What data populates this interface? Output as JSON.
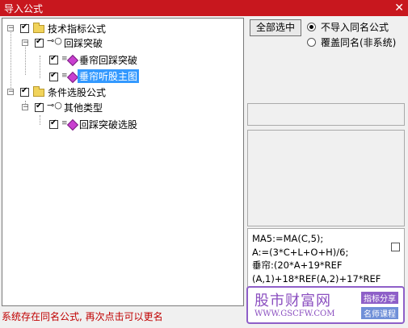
{
  "window": {
    "title": "导入公式",
    "close_glyph": "✕"
  },
  "tree": {
    "nodes": [
      {
        "label": "技术指标公式",
        "expander": "−",
        "icon": "folder-icon",
        "checked": true
      },
      {
        "label": "回踩突破",
        "expander": "−",
        "icon": "key-icon",
        "checked": true
      },
      {
        "label": "垂帘回踩突破",
        "icon": "formula-icon",
        "checked": true
      },
      {
        "label": "垂帘听股主图",
        "icon": "formula-icon",
        "checked": true,
        "selected": true
      },
      {
        "label": "条件选股公式",
        "expander": "−",
        "icon": "folder-icon",
        "checked": true
      },
      {
        "label": "其他类型",
        "expander": "−",
        "icon": "key-icon",
        "checked": true
      },
      {
        "label": "回踩突破选股",
        "icon": "formula-icon",
        "checked": true
      }
    ]
  },
  "buttons": {
    "select_all": "全部选中"
  },
  "options": {
    "no_import": "不导入同名公式",
    "overwrite": "覆盖同名(非系统)",
    "selected": "no_import"
  },
  "formula_preview": {
    "lines": [
      "MA5:=MA(C,5);",
      "A:=(3*C+L+O+H)/6;",
      "垂帘:(20*A+19*REF",
      "(A,1)+18*REF(A,2)+17*REF"
    ]
  },
  "status": "系统存在同名公式, 再次点击可以更名",
  "watermark": {
    "name": "股市财富网",
    "url": "WWW.GSCFW.COM",
    "tag1": "指标分享",
    "tag2": "名师课程"
  },
  "colors": {
    "titlebar": "#c8171e",
    "selection": "#3399ff",
    "status_text": "#c00000",
    "watermark": "#8e5fc8"
  }
}
